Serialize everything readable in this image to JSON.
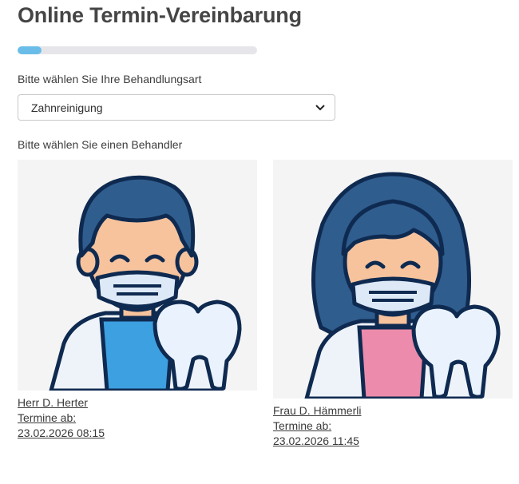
{
  "header": {
    "title": "Online Termin-Vereinbarung"
  },
  "progress": {
    "value_percent": 10,
    "fill_color": "#6bbde9",
    "track_color": "#e6e6ea"
  },
  "treatment": {
    "label": "Bitte wählen Sie Ihre Behandlungsart",
    "selected": "Zahnreinigung"
  },
  "practitioner_section": {
    "label": "Bitte wählen Sie einen Behandler"
  },
  "practitioners": [
    {
      "name": "Herr D. Herter",
      "appointments_label": "Termine ab:",
      "date": "23.02.2026 08:15",
      "shirt_color": "#3da0e0"
    },
    {
      "name": "Frau D. Hämmerli",
      "appointments_label": "Termine ab:",
      "date": "23.02.2026 11:45",
      "shirt_color": "#ec8bab"
    }
  ]
}
